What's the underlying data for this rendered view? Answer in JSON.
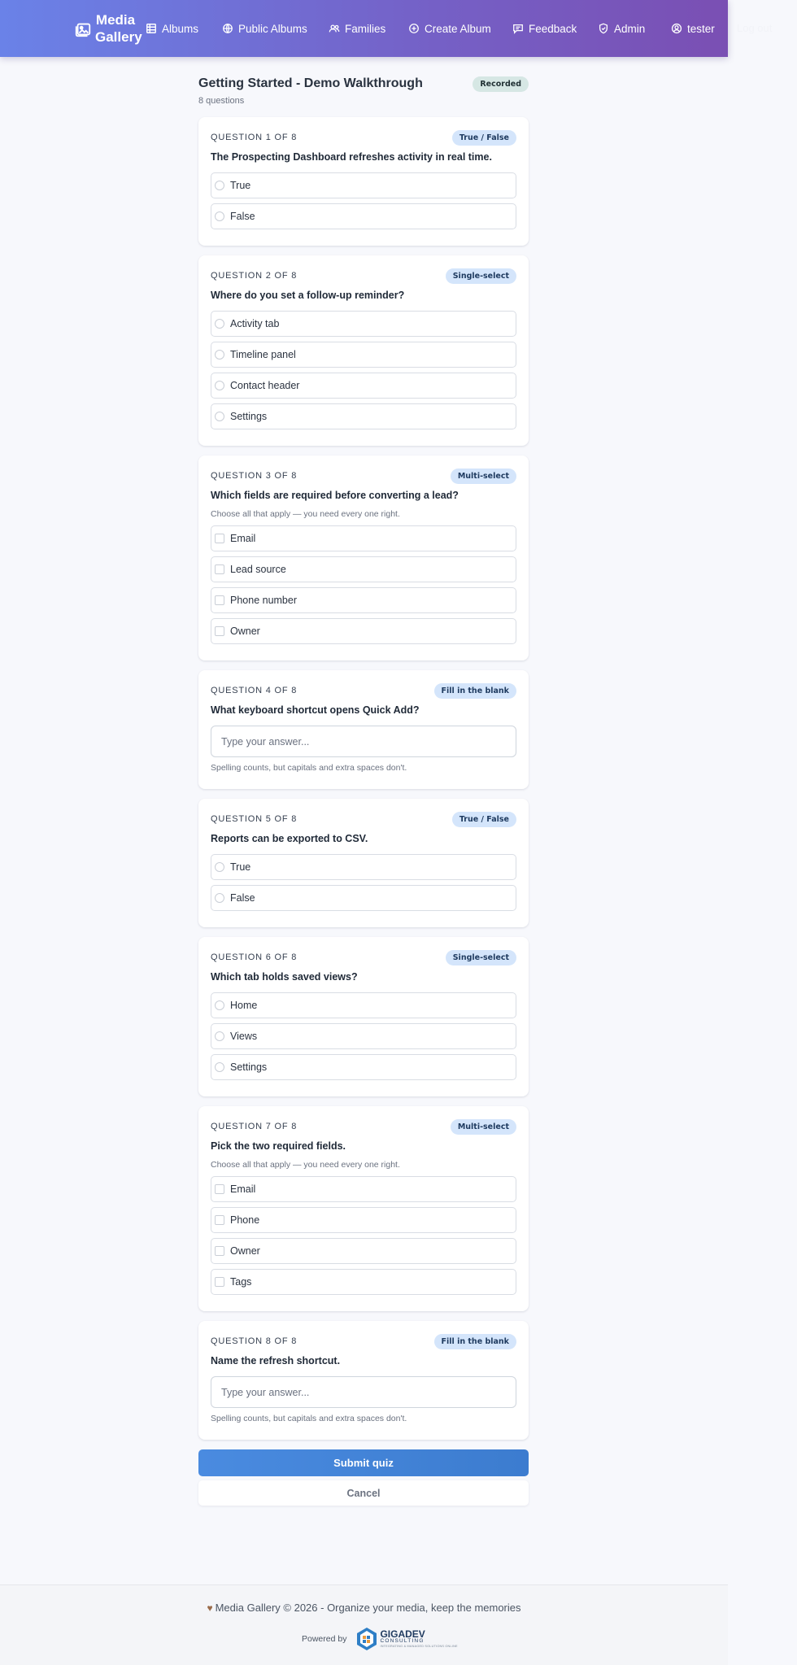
{
  "nav": {
    "brand_line1": "Media",
    "brand_line2": "Gallery",
    "items": [
      {
        "label": "Albums",
        "icon": "grid-icon"
      },
      {
        "label": "Public Albums",
        "icon": "globe-icon"
      },
      {
        "label": "Families",
        "icon": "users-icon"
      },
      {
        "label": "Create Album",
        "icon": "plus-circle-icon"
      },
      {
        "label": "Feedback",
        "icon": "message-icon"
      },
      {
        "label": "Admin",
        "icon": "shield-icon"
      },
      {
        "label": "tester",
        "icon": "user-circle-icon"
      }
    ],
    "overflow_text": "Log out"
  },
  "quiz": {
    "title": "Getting Started - Demo Walkthrough",
    "subtitle": "8 questions",
    "status": "Recorded",
    "questions": [
      {
        "number": "QUESTION 1 OF 8",
        "type": "True / False",
        "text": "The Prospecting Dashboard refreshes activity in real time.",
        "options": [
          "True",
          "False"
        ]
      },
      {
        "number": "QUESTION 2 OF 8",
        "type": "Single-select",
        "text": "Where do you set a follow-up reminder?",
        "options": [
          "Activity tab",
          "Timeline panel",
          "Contact header",
          "Settings"
        ]
      },
      {
        "number": "QUESTION 3 OF 8",
        "type": "Multi-select",
        "text": "Which fields are required before converting a lead?",
        "hint": "Choose all that apply — you need every one right.",
        "options": [
          "Email",
          "Lead source",
          "Phone number",
          "Owner"
        ]
      },
      {
        "number": "QUESTION 4 OF 8",
        "type": "Fill in the blank",
        "text": "What keyboard shortcut opens Quick Add?",
        "placeholder": "Type your answer...",
        "help": "Spelling counts, but capitals and extra spaces don't."
      },
      {
        "number": "QUESTION 5 OF 8",
        "type": "True / False",
        "text": "Reports can be exported to CSV.",
        "options": [
          "True",
          "False"
        ]
      },
      {
        "number": "QUESTION 6 OF 8",
        "type": "Single-select",
        "text": "Which tab holds saved views?",
        "options": [
          "Home",
          "Views",
          "Settings"
        ]
      },
      {
        "number": "QUESTION 7 OF 8",
        "type": "Multi-select",
        "text": "Pick the two required fields.",
        "hint": "Choose all that apply — you need every one right.",
        "options": [
          "Email",
          "Phone",
          "Owner",
          "Tags"
        ]
      },
      {
        "number": "QUESTION 8 OF 8",
        "type": "Fill in the blank",
        "text": "Name the refresh shortcut.",
        "placeholder": "Type your answer...",
        "help": "Spelling counts, but capitals and extra spaces don't."
      }
    ],
    "submit_label": "Submit quiz",
    "cancel_label": "Cancel"
  },
  "footer": {
    "text": "Media Gallery © 2026 - Organize your media, keep the memories",
    "powered_label": "Powered by",
    "logo_name": "GIGADEV",
    "logo_sub": "CONSULTING",
    "logo_tag": "INTEGRATING & MANAGED SOLUTIONS ONLINE"
  }
}
